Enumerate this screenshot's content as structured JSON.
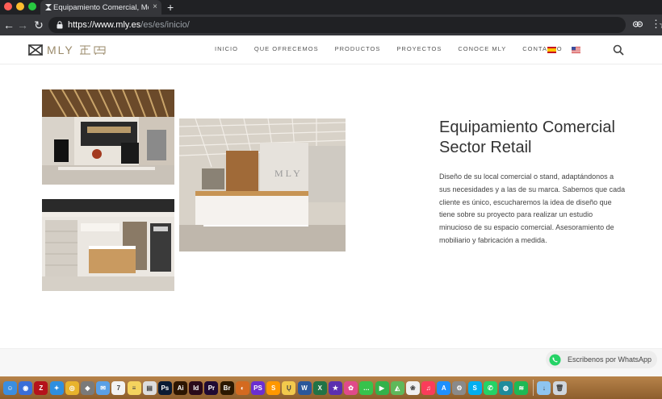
{
  "browser": {
    "tab_title": "Equipamiento Comercial, Mobil",
    "tab_close": "×",
    "new_tab": "+",
    "url_host": "https://www.mly.es",
    "url_path": "/es/es/inicio/",
    "back": "←",
    "forward": "→",
    "reload": "↻",
    "star": "☆",
    "menu": "⋮"
  },
  "header": {
    "logo_text": "MLY",
    "nav": [
      "INICIO",
      "QUE OFRECEMOS",
      "PRODUCTOS",
      "PROYECTOS",
      "CONOCE MLY",
      "CONTACTO"
    ]
  },
  "hero": {
    "title_line1": "Equipamiento Comercial",
    "title_line2": "Sector Retail",
    "description": "Diseño de su local comercial o stand, adaptándonos a sus necesidades y a las de su marca. Sabemos que cada cliente es único, escucharemos la idea de diseño que tiene sobre su proyecto para realizar un estudio minucioso de su espacio comercial. Asesoramiento de mobiliario y fabricación a medida."
  },
  "whatsapp": {
    "label": "Escribenos por WhatsApp",
    "color": "#25d366"
  },
  "dock": {
    "icons": [
      {
        "name": "finder-icon",
        "color": "#3b8ee0",
        "glyph": "☺"
      },
      {
        "name": "app-blue-icon",
        "color": "#3a6ed8",
        "glyph": "◉"
      },
      {
        "name": "filezilla-icon",
        "color": "#b5121b",
        "glyph": "Z"
      },
      {
        "name": "safari-icon",
        "color": "#2f8fe0",
        "glyph": "✦"
      },
      {
        "name": "chrome-icon",
        "color": "#e8b32c",
        "glyph": "◎"
      },
      {
        "name": "app-grey-icon",
        "color": "#7a7a7a",
        "glyph": "◆"
      },
      {
        "name": "mail-icon",
        "color": "#5aa0e6",
        "glyph": "✉"
      },
      {
        "name": "calendar-icon",
        "color": "#f2f2f2",
        "glyph": "7"
      },
      {
        "name": "notes-icon",
        "color": "#f4d35e",
        "glyph": "≡"
      },
      {
        "name": "preview-icon",
        "color": "#dddddd",
        "glyph": "▤"
      },
      {
        "name": "photoshop-icon",
        "color": "#0a1b33",
        "glyph": "Ps"
      },
      {
        "name": "illustrator-icon",
        "color": "#2d1600",
        "glyph": "Ai"
      },
      {
        "name": "indesign-icon",
        "color": "#2a0a1a",
        "glyph": "Id"
      },
      {
        "name": "premiere-icon",
        "color": "#1f0a33",
        "glyph": "Pr"
      },
      {
        "name": "bridge-icon",
        "color": "#2b1800",
        "glyph": "Br"
      },
      {
        "name": "app-orange-icon",
        "color": "#d46a20",
        "glyph": "◐"
      },
      {
        "name": "phpstorm-icon",
        "color": "#6b2fd1",
        "glyph": "PS"
      },
      {
        "name": "sublime-icon",
        "color": "#ff9800",
        "glyph": "S"
      },
      {
        "name": "app-yellow-icon",
        "color": "#f2c94c",
        "glyph": "Ų"
      },
      {
        "name": "word-icon",
        "color": "#2b579a",
        "glyph": "W"
      },
      {
        "name": "excel-icon",
        "color": "#217346",
        "glyph": "X"
      },
      {
        "name": "app-star-icon",
        "color": "#5b2fb0",
        "glyph": "★"
      },
      {
        "name": "app-pink-icon",
        "color": "#e04a8a",
        "glyph": "✿"
      },
      {
        "name": "messages-icon",
        "color": "#37c24c",
        "glyph": "…"
      },
      {
        "name": "facetime-icon",
        "color": "#33b24a",
        "glyph": "▶"
      },
      {
        "name": "maps-icon",
        "color": "#5fb85a",
        "glyph": "◭"
      },
      {
        "name": "photos-icon",
        "color": "#f0f0f0",
        "glyph": "❀"
      },
      {
        "name": "music-icon",
        "color": "#fa3c5a",
        "glyph": "♫"
      },
      {
        "name": "app-store-icon",
        "color": "#1e90ff",
        "glyph": "A"
      },
      {
        "name": "system-prefs-icon",
        "color": "#8a8a8a",
        "glyph": "⚙"
      },
      {
        "name": "skype-icon",
        "color": "#00aff0",
        "glyph": "S"
      },
      {
        "name": "whatsapp-dock-icon",
        "color": "#25d366",
        "glyph": "✆"
      },
      {
        "name": "app-teal-icon",
        "color": "#1e8c9c",
        "glyph": "◍"
      },
      {
        "name": "spotify-icon",
        "color": "#1db954",
        "glyph": "≋"
      }
    ],
    "trailing": [
      {
        "name": "downloads-icon",
        "color": "#8ec5f0",
        "glyph": "↓"
      },
      {
        "name": "trash-icon",
        "color": "#cfd6dd",
        "glyph": "🗑"
      }
    ]
  },
  "colors": {
    "browser_dark": "#202124",
    "browser_toolbar": "#35363a",
    "logo_gold": "#9a8a6a",
    "text": "#333333"
  }
}
